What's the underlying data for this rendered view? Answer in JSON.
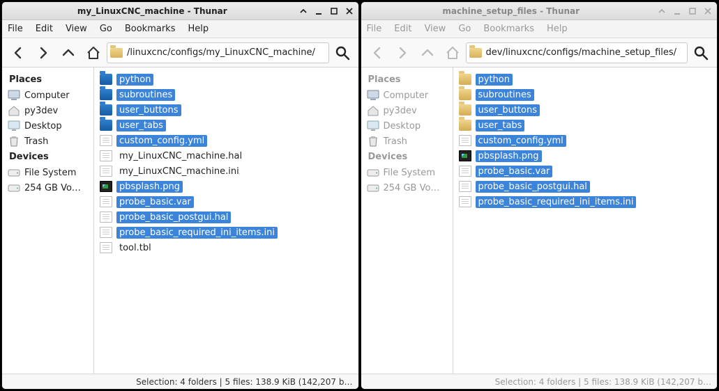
{
  "windows": [
    {
      "active": true,
      "title": "my_LinuxCNC_machine - Thunar",
      "path": "/linuxcnc/configs/my_LinuxCNC_machine/",
      "status": "Selection: 4 folders  |  5 files: 138.9 KiB (142,207 b…",
      "files": [
        {
          "name": "python",
          "type": "folder",
          "selected": true
        },
        {
          "name": "subroutines",
          "type": "folder",
          "selected": true
        },
        {
          "name": "user_buttons",
          "type": "folder",
          "selected": true
        },
        {
          "name": "user_tabs",
          "type": "folder",
          "selected": true
        },
        {
          "name": "custom_config.yml",
          "type": "file",
          "selected": true
        },
        {
          "name": "my_LinuxCNC_machine.hal",
          "type": "file",
          "selected": false
        },
        {
          "name": "my_LinuxCNC_machine.ini",
          "type": "file",
          "selected": false
        },
        {
          "name": "pbsplash.png",
          "type": "image",
          "selected": true
        },
        {
          "name": "probe_basic.var",
          "type": "file",
          "selected": true
        },
        {
          "name": "probe_basic_postgui.hal",
          "type": "file",
          "selected": true
        },
        {
          "name": "probe_basic_required_ini_items.ini",
          "type": "file",
          "selected": true
        },
        {
          "name": "tool.tbl",
          "type": "file",
          "selected": false
        }
      ]
    },
    {
      "active": false,
      "title": "machine_setup_files - Thunar",
      "path": "dev/linuxcnc/configs/machine_setup_files/",
      "status": "Selection: 4 folders  |  5 files: 138.9 KiB (142,207 b…",
      "files": [
        {
          "name": "python",
          "type": "folder-tan",
          "selected": true
        },
        {
          "name": "subroutines",
          "type": "folder-tan",
          "selected": true
        },
        {
          "name": "user_buttons",
          "type": "folder-tan",
          "selected": true
        },
        {
          "name": "user_tabs",
          "type": "folder-tan",
          "selected": true
        },
        {
          "name": "custom_config.yml",
          "type": "file",
          "selected": true
        },
        {
          "name": "pbsplash.png",
          "type": "image",
          "selected": true
        },
        {
          "name": "probe_basic.var",
          "type": "file",
          "selected": true
        },
        {
          "name": "probe_basic_postgui.hal",
          "type": "file",
          "selected": true
        },
        {
          "name": "probe_basic_required_ini_items.ini",
          "type": "file",
          "selected": true
        }
      ]
    }
  ],
  "menu": [
    "File",
    "Edit",
    "View",
    "Go",
    "Bookmarks",
    "Help"
  ],
  "sidebar": {
    "places_label": "Places",
    "devices_label": "Devices",
    "places": [
      {
        "name": "Computer",
        "icon": "computer"
      },
      {
        "name": "py3dev",
        "icon": "home"
      },
      {
        "name": "Desktop",
        "icon": "desktop"
      },
      {
        "name": "Trash",
        "icon": "trash"
      }
    ],
    "devices": [
      {
        "name": "File System",
        "icon": "disk"
      },
      {
        "name": "254 GB Vo…",
        "icon": "disk"
      }
    ]
  }
}
